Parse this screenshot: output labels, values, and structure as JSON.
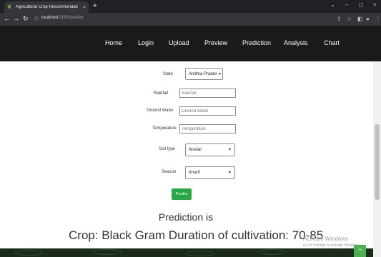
{
  "browser": {
    "tab_title": "Agricultural Crop Recommendati",
    "tab_close": "×",
    "new_tab": "+",
    "url_host": "localhost",
    "url_path": ":5000/predict",
    "minimize": "⌄",
    "restore": "–",
    "maximize": "◻",
    "close": "×"
  },
  "navbar": {
    "items": [
      {
        "label": "Home"
      },
      {
        "label": "Login"
      },
      {
        "label": "Upload"
      },
      {
        "label": "Preview"
      },
      {
        "label": "Prediction"
      },
      {
        "label": "Analysis"
      },
      {
        "label": "Chart"
      }
    ]
  },
  "form": {
    "state_label": "State",
    "state_value": "Andhra Prades",
    "rainfall_label": "Rainfall",
    "rainfall_placeholder": "Rainfall",
    "groundwater_label": "Ground Water",
    "groundwater_placeholder": "Ground Water",
    "temperature_label": "Temperature",
    "temperature_placeholder": "Temperature",
    "soil_label": "Soil type",
    "soil_value": "Aluvial",
    "season_label": "Season",
    "season_value": "Kharif",
    "predict_label": "Predict"
  },
  "result": {
    "title": "Prediction is",
    "text": "Crop: Black Gram Duration of cultivation: 70-85"
  },
  "watermark": {
    "line1": "Activate Windows",
    "line2": "Go to Settings to activate Windows."
  }
}
